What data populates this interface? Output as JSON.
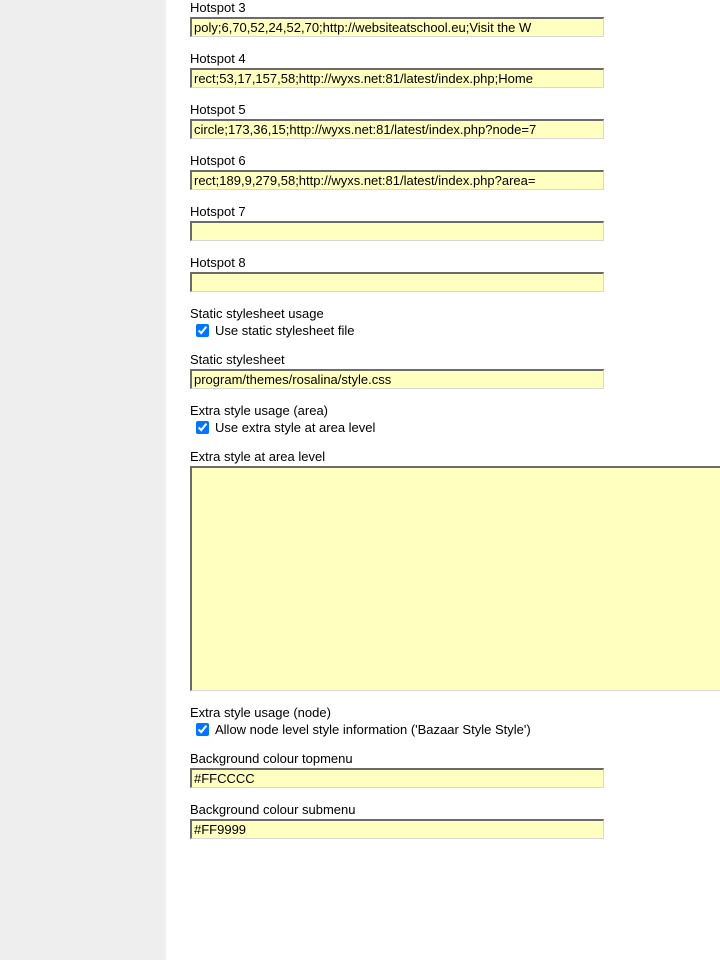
{
  "hotspots": [
    {
      "label": "Hotspot 3",
      "value": "poly;6,70,52,24,52,70;http://websiteatschool.eu;Visit the W"
    },
    {
      "label": "Hotspot 4",
      "value": "rect;53,17,157,58;http://wyxs.net:81/latest/index.php;Home"
    },
    {
      "label": "Hotspot 5",
      "value": "circle;173,36,15;http://wyxs.net:81/latest/index.php?node=7"
    },
    {
      "label": "Hotspot 6",
      "value": "rect;189,9,279,58;http://wyxs.net:81/latest/index.php?area="
    },
    {
      "label": "Hotspot 7",
      "value": ""
    },
    {
      "label": "Hotspot 8",
      "value": ""
    }
  ],
  "static_stylesheet_usage": {
    "label": "Static stylesheet usage",
    "checkbox_label": "Use static stylesheet file",
    "checked": true
  },
  "static_stylesheet": {
    "label": "Static stylesheet",
    "value": "program/themes/rosalina/style.css"
  },
  "extra_style_area_usage": {
    "label": "Extra style usage (area)",
    "checkbox_label": "Use extra style at area level",
    "checked": true
  },
  "extra_style_area": {
    "label": "Extra style at area level",
    "value": ""
  },
  "extra_style_node_usage": {
    "label": "Extra style usage (node)",
    "checkbox_label": "Allow node level style information ('Bazaar Style Style')",
    "checked": true
  },
  "bg_topmenu": {
    "label": "Background colour topmenu",
    "value": "#FFCCCC"
  },
  "bg_submenu": {
    "label": "Background colour submenu",
    "value": "#FF9999"
  }
}
